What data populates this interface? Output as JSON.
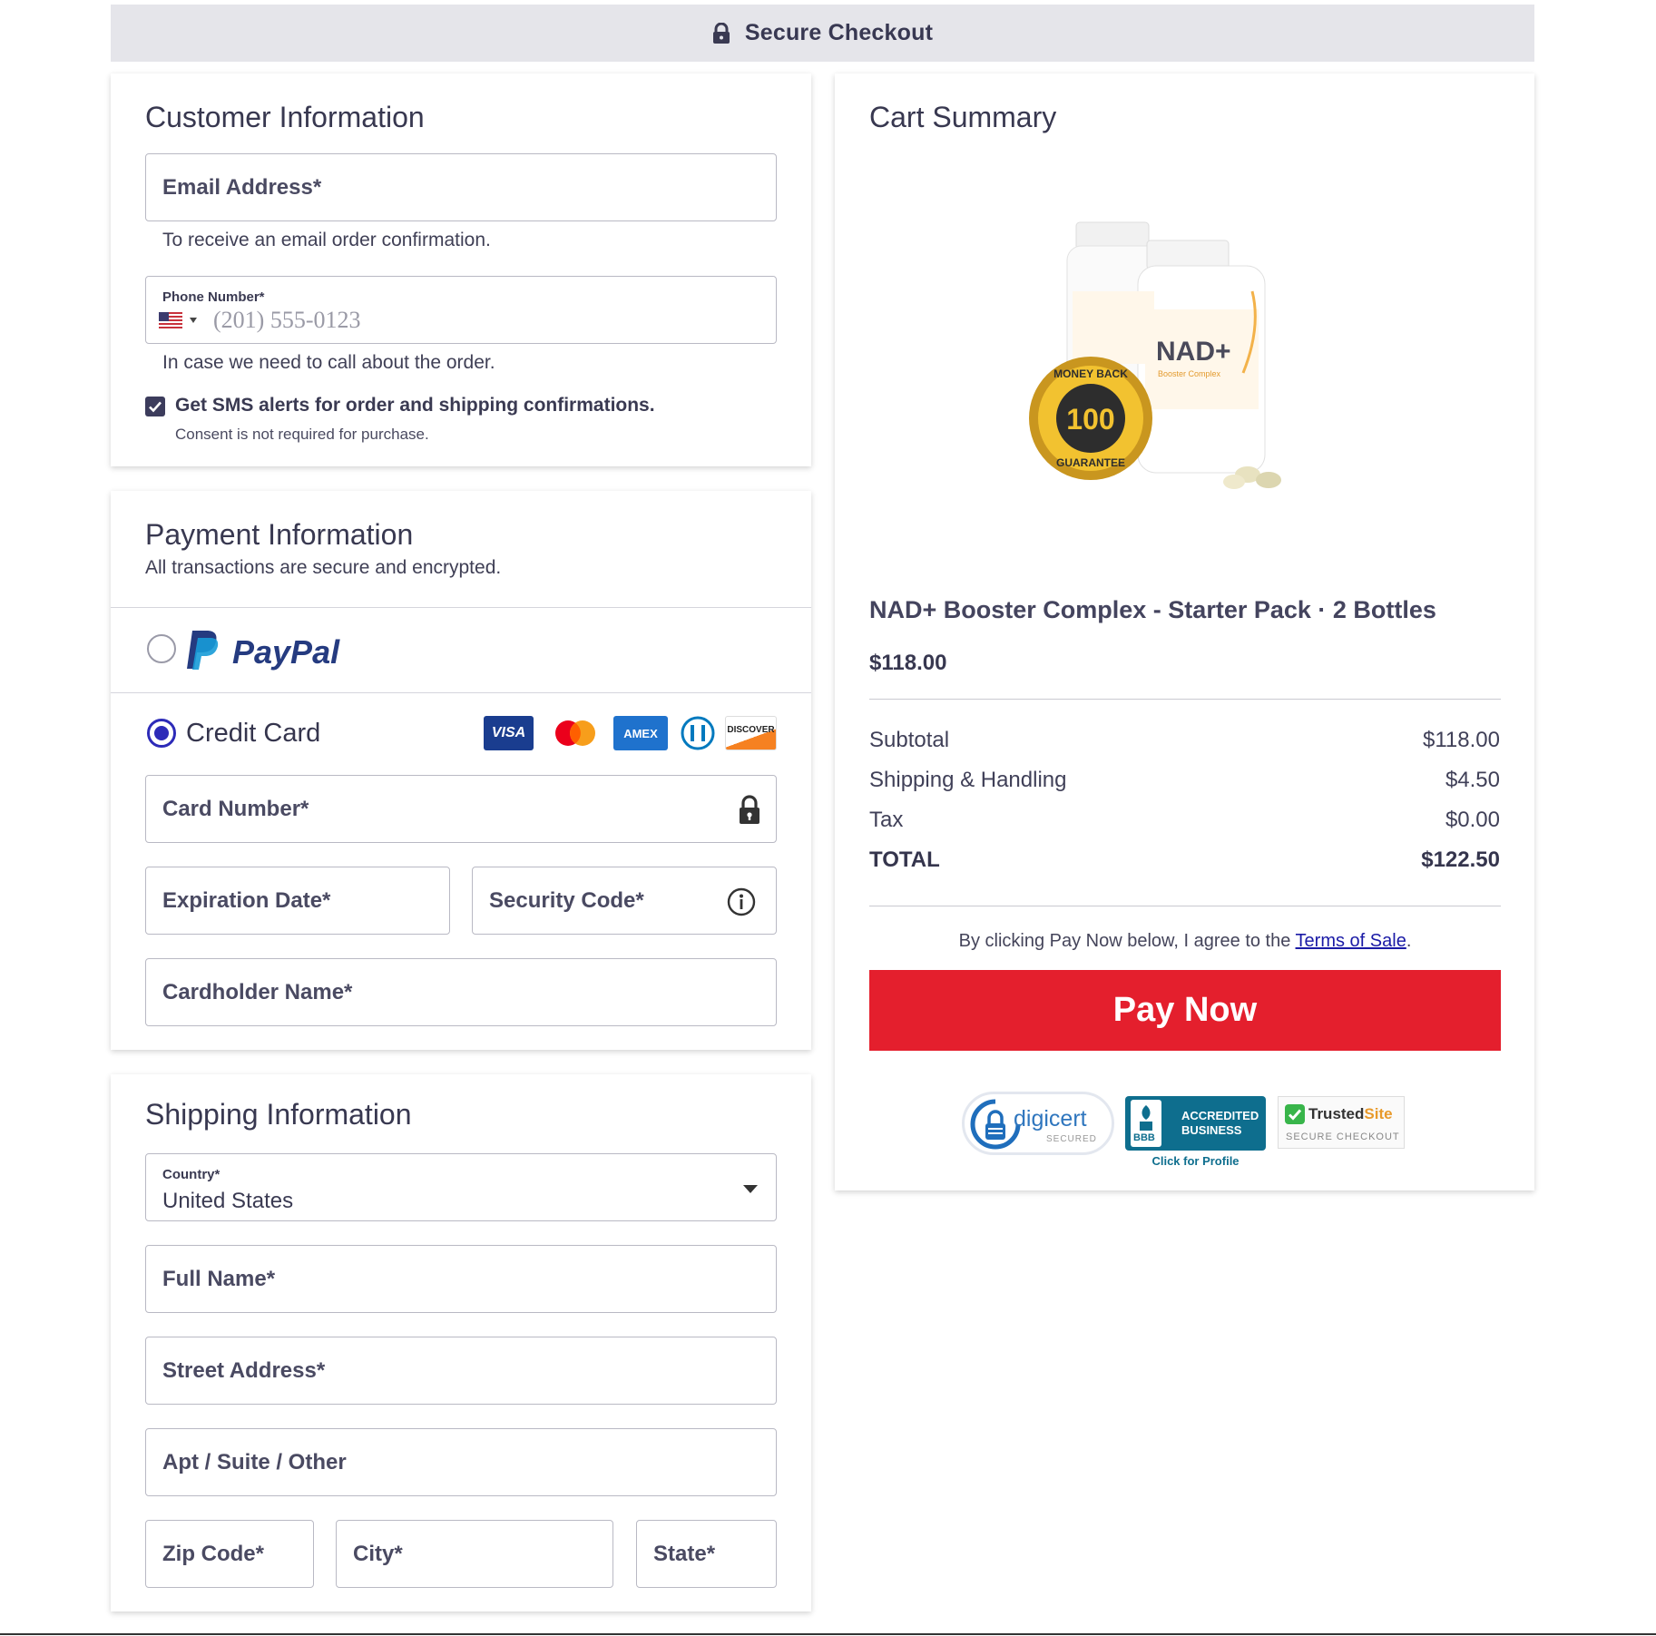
{
  "header": {
    "title": "Secure Checkout",
    "icon": "lock-icon"
  },
  "customer": {
    "heading": "Customer Information",
    "email_label": "Email Address*",
    "email_hint": "To receive an email order confirmation.",
    "phone_label": "Phone Number*",
    "phone_placeholder": "(201) 555-0123",
    "phone_hint": "In case we need to call about the order.",
    "sms_label": "Get SMS alerts for order and shipping confirmations.",
    "sms_sub": "Consent is not required for purchase.",
    "sms_checked": true
  },
  "payment": {
    "heading": "Payment Information",
    "subheading": "All transactions are secure and encrypted.",
    "paypal_label": "PayPal",
    "credit_label": "Credit Card",
    "selected": "credit-card",
    "card_logos": [
      "VISA",
      "mastercard",
      "AMEX",
      "diners",
      "DISCOVER"
    ],
    "card_number_label": "Card Number*",
    "expiration_label": "Expiration Date*",
    "security_label": "Security Code*",
    "cardholder_label": "Cardholder Name*"
  },
  "shipping": {
    "heading": "Shipping Information",
    "country_label": "Country*",
    "country_value": "United States",
    "full_name_label": "Full Name*",
    "street_label": "Street Address*",
    "apt_label": "Apt / Suite / Other",
    "zip_label": "Zip Code*",
    "city_label": "City*",
    "state_label": "State*"
  },
  "cart": {
    "heading": "Cart Summary",
    "product_name": "NAD+ Booster Complex - Starter Pack · 2 Bottles",
    "product_price": "$118.00",
    "image_text": {
      "bottle_label": "NAD+",
      "bottle_sub": "Booster Complex",
      "badge_top": "MONEY BACK",
      "badge_mid": "100",
      "badge_bottom": "GUARANTEE"
    },
    "rows": [
      {
        "label": "Subtotal",
        "value": "$118.00"
      },
      {
        "label": "Shipping & Handling",
        "value": "$4.50"
      },
      {
        "label": "Tax",
        "value": "$0.00"
      }
    ],
    "total_label": "TOTAL",
    "total_value": "$122.50",
    "agree_prefix": "By clicking Pay Now below, I agree to the ",
    "terms_link": "Terms of Sale",
    "agree_suffix": ".",
    "pay_button": "Pay Now",
    "trust": {
      "digicert": "digicert",
      "digicert_sub": "SECURED",
      "bbb_line1": "ACCREDITED",
      "bbb_line2": "BUSINESS",
      "bbb_mark": "BBB",
      "bbb_caption": "Click for Profile",
      "trusted_a": "Trusted",
      "trusted_b": "Site",
      "trusted_sub": "SECURE CHECKOUT"
    }
  },
  "colors": {
    "accent": "#2d2bb8",
    "pay_button": "#e41f2d",
    "header_bg": "#e5e5ea",
    "link": "#1a1aa6"
  }
}
